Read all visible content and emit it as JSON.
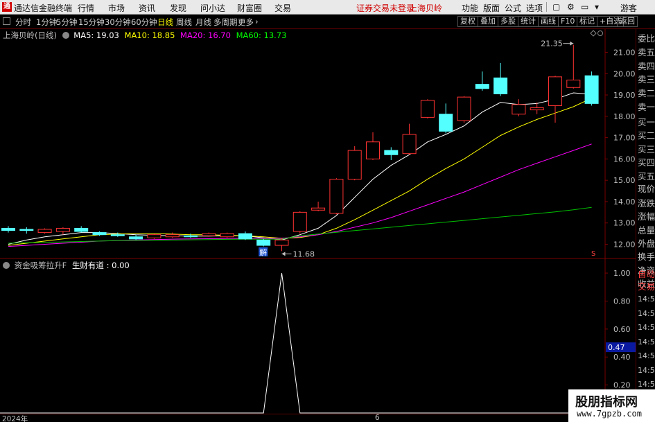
{
  "menubar": {
    "app_title": "通达信金融终端",
    "menus": [
      "行情",
      "市场",
      "资讯",
      "发现",
      "问小达",
      "财富圈",
      "交易"
    ],
    "status": "证券交易未登录",
    "stock_name": "上海贝岭",
    "right_menus": [
      "功能",
      "版面",
      "公式",
      "选项"
    ],
    "guest": "游客"
  },
  "toolbar": {
    "periods": [
      "分时",
      "1分钟",
      "5分钟",
      "15分钟",
      "30分钟",
      "60分钟",
      "日线",
      "周线",
      "月线",
      "多周期",
      "更多"
    ],
    "active_period": "日线",
    "right_buttons": [
      "复权",
      "叠加",
      "多股",
      "统计",
      "画线",
      "F10",
      "标记",
      "+自选",
      "返回"
    ]
  },
  "main_chart": {
    "stock_label": "上海贝岭(日线)",
    "ma_legend": [
      {
        "label": "MA5: 19.03",
        "color": "#ffffff"
      },
      {
        "label": "MA10: 18.85",
        "color": "#ffff00"
      },
      {
        "label": "MA20: 16.70",
        "color": "#ff00ff"
      },
      {
        "label": "MA60: 13.73",
        "color": "#00ff00"
      }
    ],
    "high_marker": "21.35",
    "low_marker": "11.68",
    "event_tag": "解",
    "s_tag": "S",
    "colors": {
      "up": "#ff3232",
      "down": "#54ffff",
      "grid": "#7a0000"
    }
  },
  "chart_data": {
    "type": "candlestick",
    "x_axis_labels": [
      "2024年",
      "6"
    ],
    "y_ticks": [
      "21.00",
      "20.00",
      "19.00",
      "18.00",
      "17.00",
      "16.00",
      "15.00",
      "14.00",
      "13.00",
      "12.00"
    ],
    "ylim": [
      11.4,
      21.6
    ],
    "candles": [
      {
        "o": 12.75,
        "c": 12.65,
        "h": 12.85,
        "l": 12.55
      },
      {
        "o": 12.7,
        "c": 12.65,
        "h": 12.8,
        "l": 12.5
      },
      {
        "o": 12.55,
        "c": 12.7,
        "h": 12.75,
        "l": 12.5
      },
      {
        "o": 12.6,
        "c": 12.75,
        "h": 12.8,
        "l": 12.45
      },
      {
        "o": 12.75,
        "c": 12.6,
        "h": 12.85,
        "l": 12.55
      },
      {
        "o": 12.55,
        "c": 12.45,
        "h": 12.6,
        "l": 12.4
      },
      {
        "o": 12.45,
        "c": 12.4,
        "h": 12.55,
        "l": 12.35
      },
      {
        "o": 12.35,
        "c": 12.25,
        "h": 12.45,
        "l": 12.2
      },
      {
        "o": 12.3,
        "c": 12.45,
        "h": 12.5,
        "l": 12.25
      },
      {
        "o": 12.35,
        "c": 12.45,
        "h": 12.55,
        "l": 12.3
      },
      {
        "o": 12.4,
        "c": 12.35,
        "h": 12.5,
        "l": 12.3
      },
      {
        "o": 12.4,
        "c": 12.5,
        "h": 12.55,
        "l": 12.35
      },
      {
        "o": 12.35,
        "c": 12.5,
        "h": 12.55,
        "l": 12.3
      },
      {
        "o": 12.5,
        "c": 12.25,
        "h": 12.6,
        "l": 12.2
      },
      {
        "o": 12.2,
        "c": 11.95,
        "h": 12.25,
        "l": 11.9
      },
      {
        "o": 11.95,
        "c": 12.2,
        "h": 12.3,
        "l": 11.68
      },
      {
        "o": 12.6,
        "c": 13.5,
        "h": 13.55,
        "l": 12.5
      },
      {
        "o": 13.6,
        "c": 13.7,
        "h": 14.0,
        "l": 13.55
      },
      {
        "o": 13.45,
        "c": 15.05,
        "h": 15.1,
        "l": 13.4
      },
      {
        "o": 15.05,
        "c": 16.4,
        "h": 16.6,
        "l": 15.0
      },
      {
        "o": 16.0,
        "c": 16.8,
        "h": 17.25,
        "l": 15.95
      },
      {
        "o": 16.4,
        "c": 16.2,
        "h": 16.55,
        "l": 15.95
      },
      {
        "o": 16.25,
        "c": 17.15,
        "h": 17.65,
        "l": 16.2
      },
      {
        "o": 17.95,
        "c": 18.75,
        "h": 18.8,
        "l": 17.9
      },
      {
        "o": 18.1,
        "c": 17.3,
        "h": 18.6,
        "l": 17.2
      },
      {
        "o": 17.8,
        "c": 18.9,
        "h": 18.95,
        "l": 17.7
      },
      {
        "o": 19.5,
        "c": 19.3,
        "h": 20.1,
        "l": 19.2
      },
      {
        "o": 19.8,
        "c": 19.05,
        "h": 20.5,
        "l": 18.95
      },
      {
        "o": 18.1,
        "c": 18.55,
        "h": 18.8,
        "l": 18.0
      },
      {
        "o": 18.3,
        "c": 18.4,
        "h": 18.65,
        "l": 18.1
      },
      {
        "o": 18.5,
        "c": 19.85,
        "h": 19.9,
        "l": 17.7
      },
      {
        "o": 19.35,
        "c": 19.7,
        "h": 21.35,
        "l": 19.3
      },
      {
        "o": 19.9,
        "c": 18.6,
        "h": 20.1,
        "l": 18.5
      }
    ],
    "ma_series": [
      {
        "name": "MA5",
        "color": "#ffffff",
        "values": [
          12.0,
          12.2,
          12.35,
          12.45,
          12.55,
          12.55,
          12.5,
          12.45,
          12.42,
          12.4,
          12.38,
          12.38,
          12.4,
          12.4,
          12.3,
          12.2,
          12.45,
          12.75,
          13.35,
          14.2,
          15.05,
          15.7,
          16.2,
          16.8,
          17.15,
          17.55,
          18.2,
          18.65,
          18.55,
          18.6,
          18.8,
          19.1,
          19.03
        ]
      },
      {
        "name": "MA10",
        "color": "#ffff00",
        "values": [
          11.95,
          12.05,
          12.15,
          12.25,
          12.35,
          12.45,
          12.48,
          12.5,
          12.5,
          12.48,
          12.45,
          12.45,
          12.42,
          12.4,
          12.35,
          12.28,
          12.32,
          12.45,
          12.75,
          13.15,
          13.6,
          14.05,
          14.5,
          15.05,
          15.55,
          16.0,
          16.55,
          17.1,
          17.5,
          17.85,
          18.15,
          18.45,
          18.85
        ]
      },
      {
        "name": "MA20",
        "color": "#ff00ff",
        "values": [
          11.9,
          11.95,
          12.0,
          12.05,
          12.1,
          12.15,
          12.18,
          12.2,
          12.22,
          12.24,
          12.25,
          12.26,
          12.27,
          12.28,
          12.28,
          12.28,
          12.35,
          12.45,
          12.6,
          12.8,
          13.0,
          13.25,
          13.55,
          13.85,
          14.15,
          14.45,
          14.8,
          15.15,
          15.5,
          15.8,
          16.1,
          16.4,
          16.7
        ]
      },
      {
        "name": "MA60",
        "color": "#00c000",
        "values": [
          12.05,
          12.07,
          12.09,
          12.11,
          12.13,
          12.15,
          12.17,
          12.18,
          12.19,
          12.2,
          12.21,
          12.22,
          12.23,
          12.24,
          12.24,
          12.24,
          12.4,
          12.48,
          12.56,
          12.64,
          12.72,
          12.8,
          12.88,
          12.96,
          13.04,
          13.12,
          13.2,
          13.28,
          13.36,
          13.44,
          13.52,
          13.62,
          13.73
        ]
      }
    ]
  },
  "sub_chart": {
    "title": "资金吸筹拉升F",
    "line_label": "生财有道",
    "line_value": "0.00",
    "y_ticks": [
      "1.00",
      "0.80",
      "0.60",
      "0.40",
      "0.20"
    ],
    "current_value_box": "0.47",
    "line_color": "#ffffff",
    "values": [
      0,
      0,
      0,
      0,
      0,
      0,
      0,
      0,
      0,
      0,
      0,
      0,
      0,
      0,
      0,
      1,
      0,
      0,
      0,
      0,
      0,
      0,
      0,
      0,
      0,
      0,
      0,
      0,
      0,
      0,
      0,
      0,
      0
    ],
    "ylim": [
      0,
      1.05
    ]
  },
  "side_panel": {
    "labels": [
      "委比",
      "卖五",
      "卖四",
      "卖三",
      "卖二",
      "卖一",
      "买一",
      "买二",
      "买三",
      "买四",
      "买五",
      "现价",
      "涨跌",
      "涨幅",
      "总量",
      "外盘",
      "换手",
      "净资",
      "收益",
      "自动",
      "交易"
    ],
    "times": [
      "14:56",
      "14:56",
      "14:56",
      "14:56",
      "14:56",
      "14:56",
      "14:56",
      "14:56",
      "14:56"
    ],
    "top_badge": "R"
  },
  "watermark": {
    "line1": "股朋指标网",
    "line2": "www.7gpzb.com"
  }
}
